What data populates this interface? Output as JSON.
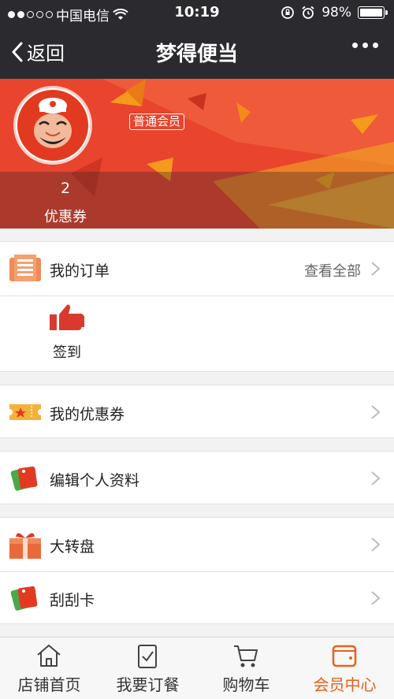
{
  "status_bar": {
    "carrier": "中国电信",
    "time": "10:19",
    "battery": "98%"
  },
  "nav": {
    "back_label": "返回",
    "title": "梦得便当"
  },
  "banner": {
    "member_level": "普通会员",
    "coupon_count": "2",
    "coupon_label": "优惠券"
  },
  "orders": {
    "label": "我的订单",
    "view_all": "查看全部"
  },
  "signin": {
    "label": "签到"
  },
  "menu": {
    "coupons": "我的优惠券",
    "edit_profile": "编辑个人资料",
    "wheel": "大转盘",
    "scratch": "刮刮卡"
  },
  "tabs": [
    {
      "label": "店铺首页",
      "icon": "home-icon"
    },
    {
      "label": "我要订餐",
      "icon": "order-clipboard-icon"
    },
    {
      "label": "购物车",
      "icon": "cart-icon"
    },
    {
      "label": "会员中心",
      "icon": "wallet-icon"
    }
  ],
  "colors": {
    "accent": "#e8601c",
    "banner": "#e8442e",
    "header": "#2b2a2e"
  }
}
